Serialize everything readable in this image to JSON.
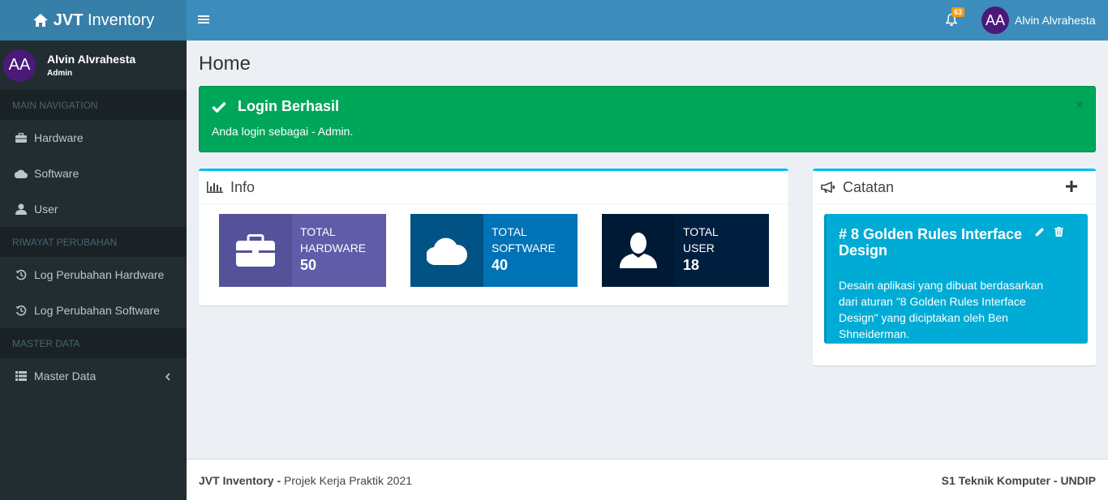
{
  "brand": {
    "bold": "JVT",
    "rest": "Inventory"
  },
  "user": {
    "initials": "AA",
    "name": "Alvin Alvrahesta",
    "role": "Admin"
  },
  "sidebar": {
    "section_main": "MAIN NAVIGATION",
    "items_main": [
      {
        "label": "Hardware",
        "icon": "briefcase-icon"
      },
      {
        "label": "Software",
        "icon": "cloud-icon"
      },
      {
        "label": "User",
        "icon": "user-icon"
      }
    ],
    "section_history": "RIWAYAT PERUBAHAN",
    "items_history": [
      {
        "label": "Log Perubahan Hardware",
        "icon": "history-icon"
      },
      {
        "label": "Log Perubahan Software",
        "icon": "history-icon"
      }
    ],
    "section_master": "MASTER DATA",
    "items_master": [
      {
        "label": "Master Data",
        "icon": "table-icon"
      }
    ]
  },
  "topbar": {
    "notification_count": "63"
  },
  "page": {
    "title": "Home"
  },
  "alert": {
    "title": "Login Berhasil",
    "text": "Anda login sebagai - Admin.",
    "close": "×"
  },
  "info": {
    "title": "Info",
    "boxes": [
      {
        "line1": "TOTAL",
        "line2": "HARDWARE",
        "value": "50",
        "icon_bg": "#555299",
        "content_bg": "#605ca8"
      },
      {
        "line1": "TOTAL",
        "line2": "SOFTWARE",
        "value": "40",
        "icon_bg": "#005384",
        "content_bg": "#0073b7"
      },
      {
        "line1": "TOTAL",
        "line2": "USER",
        "value": "18",
        "icon_bg": "#001a35",
        "content_bg": "#001f3f"
      }
    ]
  },
  "catatan": {
    "title": "Catatan",
    "note_title": "# 8 Golden Rules Interface Design",
    "note_text": "Desain aplikasi yang dibuat berdasarkan dari aturan \"8 Golden Rules Interface Design\" yang diciptakan oleh Ben Shneiderman."
  },
  "footer": {
    "brand": "JVT Inventory",
    "sep": " - ",
    "project": "Projek Kerja Praktik 2021",
    "right": "S1 Teknik Komputer - UNDIP"
  },
  "colors": {
    "sidebar": "#222d32",
    "topbar": "#3c8dbc",
    "logo": "#367fa9",
    "success": "#00a65a",
    "note": "#00acd6"
  }
}
